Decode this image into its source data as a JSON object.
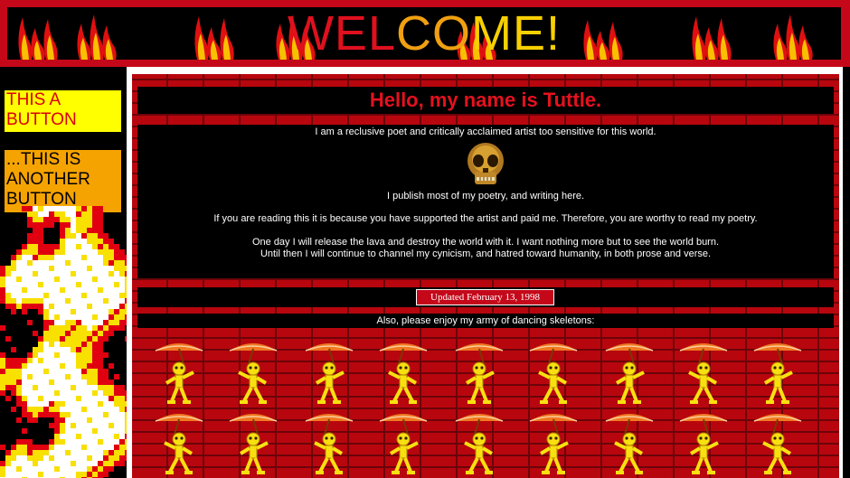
{
  "header": {
    "title_part1": "WEL",
    "title_part2": "CO",
    "title_part3": "ME!"
  },
  "sidebar": {
    "button1_label": "THIS A BUTTON",
    "button2_label": "...THIS IS ANOTHER BUTTON"
  },
  "main": {
    "heading": "Hello, my name is Tuttle.",
    "intro": "I am a reclusive poet and critically acclaimed artist too sensitive for this world.",
    "publish": "I publish most of my poetry, and writing here.",
    "support": "If you are reading this it is because you have supported the artist and paid me. Therefore, you are worthy to read my poetry.",
    "lava_line1": "One day I will release the lava and destroy the world with it. I want nothing more but to see the world burn.",
    "lava_line2": "Until then I will continue to channel my cynicism, and hatred toward humanity, in both prose and verse.",
    "updated": "Updated February 13, 1998",
    "skeletons_caption": "Also, please enjoy my army of dancing skeletons:"
  },
  "icons": {
    "skull": "skull-icon",
    "skeleton": "dancing-skeleton-icon",
    "flames": "fire-icon"
  },
  "colors": {
    "brick_red": "#b8060e",
    "heading_red": "#e5111e",
    "button1_bg": "#ffff00",
    "button2_bg": "#f5a300"
  }
}
